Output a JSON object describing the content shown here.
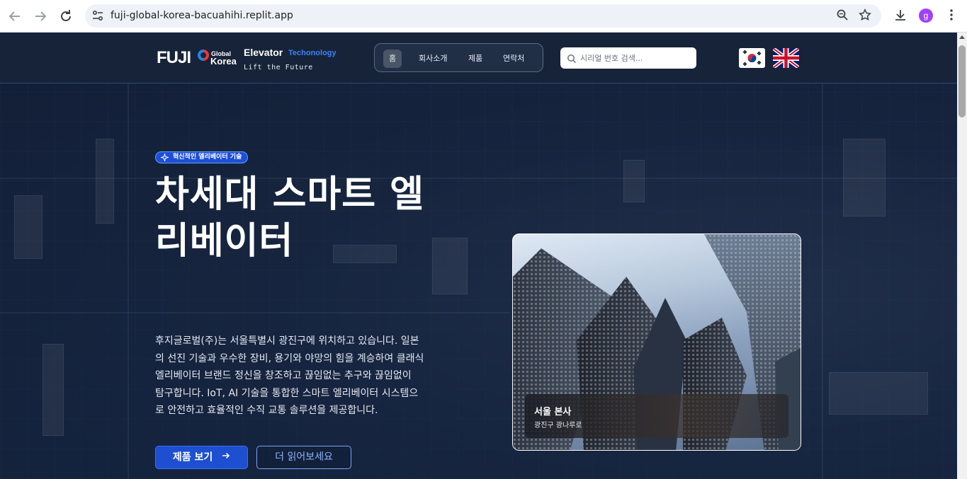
{
  "browser": {
    "url": "fuji-global-korea-bacuahihi.replit.app",
    "profile_initial": "g",
    "icons": {
      "back": "arrow-left-icon",
      "forward": "arrow-right-icon",
      "reload": "reload-icon",
      "site_info": "tune-icon",
      "zoom": "zoom-icon",
      "bookmark": "star-icon",
      "download": "download-icon",
      "menu": "kebab-menu-icon"
    }
  },
  "header": {
    "logo": {
      "fuji": "FUJI",
      "global": "Global",
      "korea": "Korea"
    },
    "brand": {
      "elevator": "Elevator",
      "technology": "Techonology",
      "tagline": "Lift the Future"
    },
    "nav": [
      {
        "label": "홈",
        "active": true
      },
      {
        "label": "회사소개",
        "active": false
      },
      {
        "label": "제품",
        "active": false
      },
      {
        "label": "연락처",
        "active": false
      }
    ],
    "search": {
      "placeholder": "시리얼 번호 검색..."
    },
    "languages": [
      {
        "code": "ko",
        "icon": "korea-flag-icon"
      },
      {
        "code": "en",
        "icon": "uk-flag-icon"
      }
    ]
  },
  "hero": {
    "badge": "혁신적인 엘리베이터 기술",
    "title_line1": "차세대 스마트 엘",
    "title_line2": "리베이터",
    "description": [
      "후지글로벌(주)는 서울특별시 광진구에 위치하고 있습니다. 일본",
      "의 선진 기술과 우수한 장비, 용기와 야망의 힘을 계승하여 클래식",
      "엘리베이터 브랜드 정신을 창조하고 끊임없는 추구와 끊임없이",
      "탐구합니다. IoT, AI 기술을 통합한 스마트 엘리베이터 시스템으",
      "로 안전하고 효율적인 수직 교통 솔루션을 제공합니다."
    ],
    "primary_button": "제품 보기",
    "secondary_button": "더 읽어보세요"
  },
  "photo_card": {
    "title": "서울 본사",
    "subtitle": "광진구 광나루로"
  },
  "colors": {
    "accent": "#1d4fd0",
    "header_bg": "#162338",
    "page_bg": "#0f1d33"
  }
}
